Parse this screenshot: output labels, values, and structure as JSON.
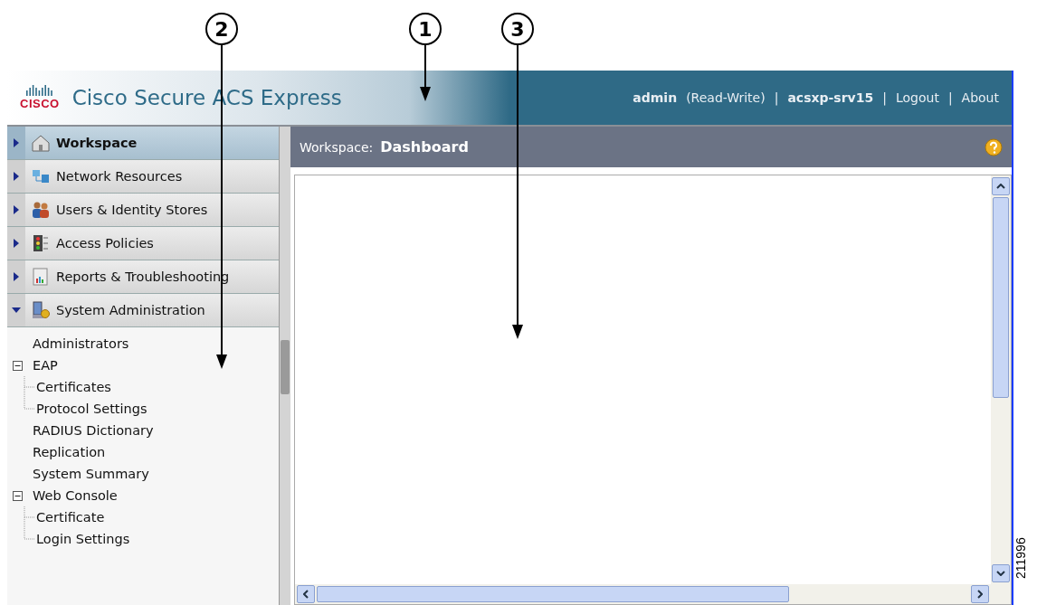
{
  "callouts": [
    {
      "label": "2"
    },
    {
      "label": "1"
    },
    {
      "label": "3"
    }
  ],
  "header": {
    "product": "Cisco Secure ACS Express",
    "logo_text": "CISCO",
    "user": "admin",
    "role": "(Read-Write)",
    "separator_1": "|",
    "server": "acsxp-srv15",
    "separator_2": "|",
    "links": [
      "Logout",
      "|",
      "About"
    ]
  },
  "sidebar": {
    "drawers": [
      {
        "label": "Workspace",
        "selected": true,
        "expanded": false
      },
      {
        "label": "Network Resources",
        "selected": false,
        "expanded": false
      },
      {
        "label": "Users & Identity Stores",
        "selected": false,
        "expanded": false
      },
      {
        "label": "Access Policies",
        "selected": false,
        "expanded": false
      },
      {
        "label": "Reports & Troubleshooting",
        "selected": false,
        "expanded": false
      },
      {
        "label": "System Administration",
        "selected": false,
        "expanded": true
      }
    ],
    "tree": [
      {
        "label": "Administrators"
      },
      {
        "label": "EAP",
        "expanded": true,
        "children": [
          {
            "label": "Certificates"
          },
          {
            "label": "Protocol Settings"
          }
        ]
      },
      {
        "label": "RADIUS Dictionary"
      },
      {
        "label": "Replication"
      },
      {
        "label": "System Summary"
      },
      {
        "label": "Web Console",
        "expanded": true,
        "children": [
          {
            "label": "Certificate"
          },
          {
            "label": "Login Settings"
          }
        ]
      }
    ]
  },
  "workspace": {
    "prefix": "Workspace:",
    "title": "Dashboard"
  },
  "figure_number": "211996"
}
